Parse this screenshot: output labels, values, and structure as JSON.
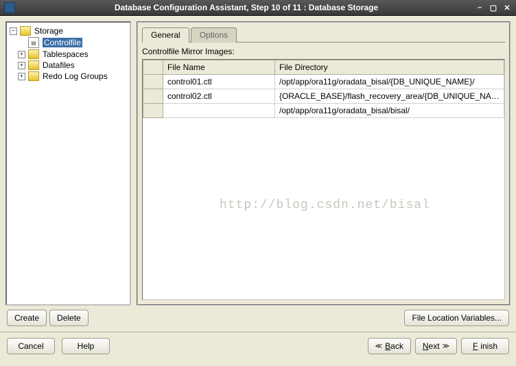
{
  "title": "Database Configuration Assistant, Step 10 of 11 : Database Storage",
  "tree": {
    "root": "Storage",
    "controlfile": "Controlfile",
    "tablespaces": "Tablespaces",
    "datafiles": "Datafiles",
    "redolog": "Redo Log Groups"
  },
  "tabs": {
    "general": "General",
    "options": "Options"
  },
  "section": {
    "label": "Controlfile Mirror Images:"
  },
  "table": {
    "col_fname": "File Name",
    "col_fdir": "File Directory",
    "rows": [
      {
        "fname": "control01.ctl",
        "fdir": "/opt/app/ora11g/oradata_bisal/{DB_UNIQUE_NAME}/"
      },
      {
        "fname": "control02.ctl",
        "fdir": "{ORACLE_BASE}/flash_recovery_area/{DB_UNIQUE_NAM..."
      },
      {
        "fname": "",
        "fdir": "/opt/app/ora11g/oradata_bisal/bisal/"
      }
    ]
  },
  "buttons": {
    "create": "Create",
    "delete": "Delete",
    "filelocvar": "File Location Variables...",
    "cancel": "Cancel",
    "help": "Help",
    "back": "Back",
    "next": "Next",
    "finish": "Finish"
  },
  "watermark": "http://blog.csdn.net/bisal"
}
